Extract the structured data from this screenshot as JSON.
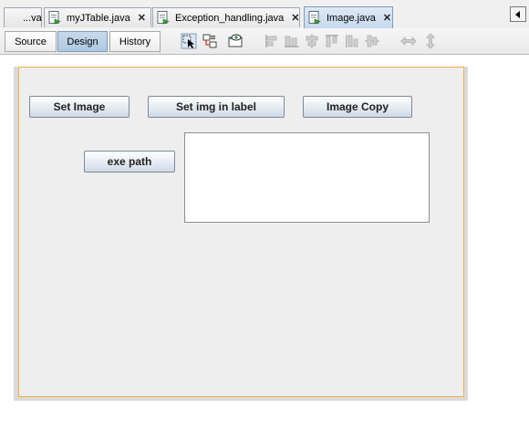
{
  "editor_tabs": [
    {
      "label": "...va",
      "icon": "none",
      "active": false
    },
    {
      "label": "myJTable.java",
      "icon": "java-file-icon",
      "active": false,
      "close": "✕"
    },
    {
      "label": "Exception_handling.java",
      "icon": "java-file-icon",
      "active": false,
      "close": "✕"
    },
    {
      "label": "Image.java",
      "icon": "java-file-icon",
      "active": true,
      "close": "✕"
    }
  ],
  "view_tabs": {
    "source": "Source",
    "design": "Design",
    "history": "History",
    "active": "Design"
  },
  "toolbar_icons": [
    "selection-mode-icon",
    "connection-mode-icon",
    "preview-design-icon",
    "align-left-icon",
    "align-right-icon",
    "center-horizontally-icon",
    "align-top-icon",
    "align-bottom-icon",
    "center-vertically-icon",
    "resize-horizontal-icon",
    "resize-vertical-icon"
  ],
  "form": {
    "buttons": {
      "set_image": "Set Image",
      "set_img_in_label": "Set img in label",
      "image_copy": "Image Copy",
      "exe_path": "exe path"
    },
    "image_label_text": ""
  },
  "colors": {
    "form_border": "#f0b04d",
    "form_background": "#eeeeee",
    "active_tab": "#c6d9ee"
  }
}
